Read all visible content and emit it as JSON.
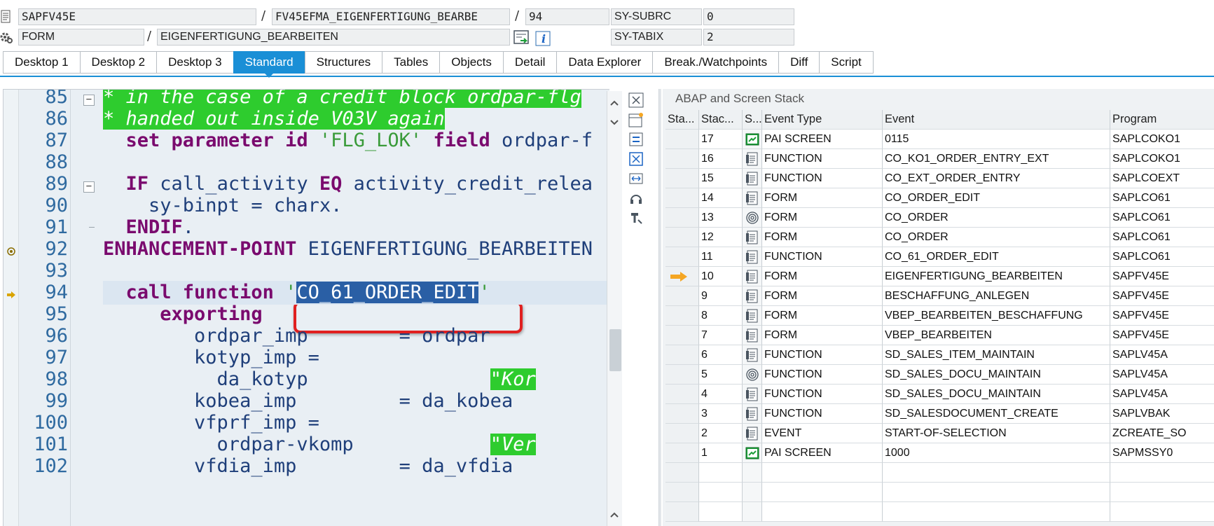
{
  "header": {
    "program": "SAPFV45E",
    "include": "FV45EFMA_EIGENFERTIGUNG_BEARBE",
    "line": "94",
    "subrc_label": "SY-SUBRC",
    "subrc_value": "0",
    "event_type": "FORM",
    "event_name": "EIGENFERTIGUNG_BEARBEITEN",
    "tabix_label": "SY-TABIX",
    "tabix_value": "2",
    "separator": "/"
  },
  "tabs": [
    {
      "label": "Desktop 1"
    },
    {
      "label": "Desktop 2"
    },
    {
      "label": "Desktop 3"
    },
    {
      "label": "Standard",
      "active": true
    },
    {
      "label": "Structures"
    },
    {
      "label": "Tables"
    },
    {
      "label": "Objects"
    },
    {
      "label": "Detail"
    },
    {
      "label": "Data Explorer"
    },
    {
      "label": "Break./Watchpoints"
    },
    {
      "label": "Diff"
    },
    {
      "label": "Script"
    }
  ],
  "editor": {
    "lines": [
      {
        "n": "85",
        "segs": [
          {
            "t": "* in the case of a credit block ordpar-flg",
            "c": "cmt"
          }
        ]
      },
      {
        "n": "86",
        "segs": [
          {
            "t": "* handed out inside V03V again",
            "c": "cmt"
          }
        ]
      },
      {
        "n": "87",
        "segs": [
          {
            "t": "  "
          },
          {
            "t": "set parameter id",
            "c": "kw"
          },
          {
            "t": " "
          },
          {
            "t": "'FLG_LOK'",
            "c": "str"
          },
          {
            "t": " "
          },
          {
            "t": "field",
            "c": "kw"
          },
          {
            "t": " ordpar-f"
          }
        ]
      },
      {
        "n": "88",
        "segs": []
      },
      {
        "n": "89",
        "segs": [
          {
            "t": "  "
          },
          {
            "t": "IF",
            "c": "kw"
          },
          {
            "t": " call_activity "
          },
          {
            "t": "EQ",
            "c": "kw"
          },
          {
            "t": " activity_credit_relea"
          }
        ]
      },
      {
        "n": "90",
        "segs": [
          {
            "t": "    sy-binpt = charx."
          }
        ]
      },
      {
        "n": "91",
        "segs": [
          {
            "t": "  "
          },
          {
            "t": "ENDIF",
            "c": "kw"
          },
          {
            "t": "."
          }
        ]
      },
      {
        "n": "92",
        "segs": [
          {
            "t": "ENHANCEMENT-POINT",
            "c": "kw"
          },
          {
            "t": " EIGENFERTIGUNG_BEARBEITEN"
          }
        ]
      },
      {
        "n": "93",
        "segs": []
      },
      {
        "n": "94",
        "current": true,
        "segs": [
          {
            "t": "  "
          },
          {
            "t": "call function",
            "c": "kw"
          },
          {
            "t": " "
          },
          {
            "t": "'",
            "c": "str"
          },
          {
            "t": "CO_61_ORDER_EDIT",
            "c": "selstr"
          },
          {
            "t": "'",
            "c": "str"
          }
        ]
      },
      {
        "n": "95",
        "segs": [
          {
            "t": "     "
          },
          {
            "t": "exporting",
            "c": "kw"
          }
        ]
      },
      {
        "n": "96",
        "segs": [
          {
            "t": "        ordpar_imp        = ordpar"
          }
        ]
      },
      {
        "n": "97",
        "segs": [
          {
            "t": "        kotyp_imp ="
          }
        ]
      },
      {
        "n": "98",
        "segs": [
          {
            "t": "          da_kotyp                "
          },
          {
            "t": "\"Kor",
            "c": "cmt"
          }
        ]
      },
      {
        "n": "99",
        "segs": [
          {
            "t": "        kobea_imp         = da_kobea"
          }
        ]
      },
      {
        "n": "100",
        "segs": [
          {
            "t": "        vfprf_imp ="
          }
        ]
      },
      {
        "n": "101",
        "segs": [
          {
            "t": "          ordpar-vkomp            "
          },
          {
            "t": "\"Ver",
            "c": "cmt"
          }
        ]
      },
      {
        "n": "102",
        "segs": [
          {
            "t": "        vfdia_imp         = da_vfdia"
          }
        ]
      }
    ]
  },
  "stack": {
    "title": "ABAP and Screen Stack",
    "columns": [
      "Sta...",
      "Stac...",
      "S...",
      "Event Type",
      "Event",
      "Program"
    ],
    "rows": [
      {
        "level": "17",
        "icon": "screen-icon",
        "type": "PAI SCREEN",
        "event": "0115",
        "program": "SAPLCOKO1"
      },
      {
        "level": "16",
        "icon": "document-icon",
        "type": "FUNCTION",
        "event": "CO_KO1_ORDER_ENTRY_EXT",
        "program": "SAPLCOKO1"
      },
      {
        "level": "15",
        "icon": "document-icon",
        "type": "FUNCTION",
        "event": "CO_EXT_ORDER_ENTRY",
        "program": "SAPLCOEXT"
      },
      {
        "level": "14",
        "icon": "document-icon",
        "type": "FORM",
        "event": "CO_ORDER_EDIT",
        "program": "SAPLCO61"
      },
      {
        "level": "13",
        "icon": "spiral-icon",
        "type": "FORM",
        "event": "CO_ORDER",
        "program": "SAPLCO61"
      },
      {
        "level": "12",
        "icon": "document-icon",
        "type": "FORM",
        "event": "CO_ORDER",
        "program": "SAPLCO61"
      },
      {
        "level": "11",
        "icon": "document-icon",
        "type": "FUNCTION",
        "event": "CO_61_ORDER_EDIT",
        "program": "SAPLCO61"
      },
      {
        "level": "10",
        "icon": "document-icon",
        "type": "FORM",
        "event": "EIGENFERTIGUNG_BEARBEITEN",
        "program": "SAPFV45E",
        "current": true
      },
      {
        "level": "9",
        "icon": "document-icon",
        "type": "FORM",
        "event": "BESCHAFFUNG_ANLEGEN",
        "program": "SAPFV45E"
      },
      {
        "level": "8",
        "icon": "document-icon",
        "type": "FORM",
        "event": "VBEP_BEARBEITEN_BESCHAFFUNG",
        "program": "SAPFV45E"
      },
      {
        "level": "7",
        "icon": "document-icon",
        "type": "FORM",
        "event": "VBEP_BEARBEITEN",
        "program": "SAPFV45E"
      },
      {
        "level": "6",
        "icon": "document-icon",
        "type": "FUNCTION",
        "event": "SD_SALES_ITEM_MAINTAIN",
        "program": "SAPLV45A"
      },
      {
        "level": "5",
        "icon": "spiral-icon",
        "type": "FUNCTION",
        "event": "SD_SALES_DOCU_MAINTAIN",
        "program": "SAPLV45A"
      },
      {
        "level": "4",
        "icon": "document-icon",
        "type": "FUNCTION",
        "event": "SD_SALES_DOCU_MAINTAIN",
        "program": "SAPLV45A"
      },
      {
        "level": "3",
        "icon": "document-icon",
        "type": "FUNCTION",
        "event": "SD_SALESDOCUMENT_CREATE",
        "program": "SAPLVBAK"
      },
      {
        "level": "2",
        "icon": "document-icon",
        "type": "EVENT",
        "event": "START-OF-SELECTION",
        "program": "ZCREATE_SO"
      },
      {
        "level": "1",
        "icon": "screen-icon",
        "type": "PAI SCREEN",
        "event": "1000",
        "program": "SAPMSSY0"
      }
    ]
  },
  "colors": {
    "accent": "#1a8fd6",
    "comment_bg": "#2ecc2e",
    "keyword": "#7a0a6e",
    "string": "#3a9b3a",
    "selection": "#2a5fa5",
    "callout": "#e02020",
    "current_arrow": "#f5a623"
  }
}
